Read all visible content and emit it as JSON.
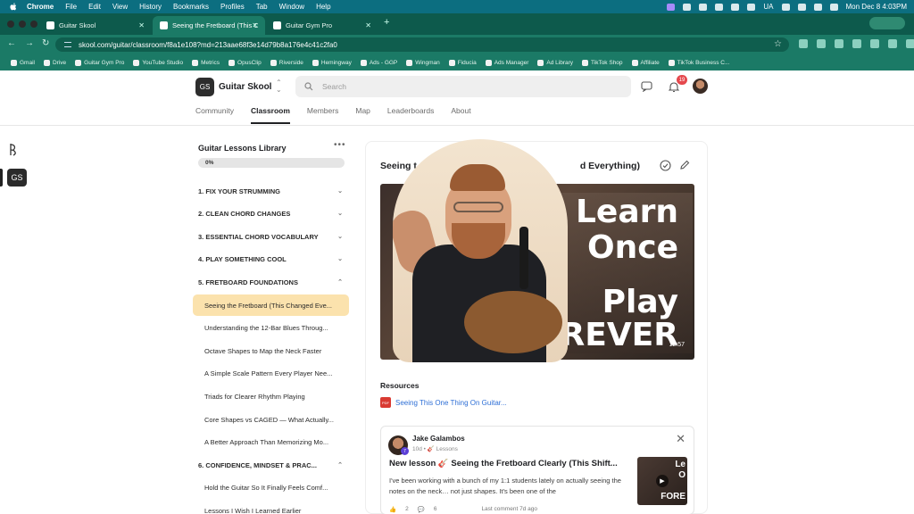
{
  "menubar": {
    "app": "Chrome",
    "items": [
      "File",
      "Edit",
      "View",
      "History",
      "Bookmarks",
      "Profiles",
      "Tab",
      "Window",
      "Help"
    ],
    "locale": "UA",
    "clock": "Mon Dec 8  4:03PM"
  },
  "tabs": [
    {
      "label": "Guitar Skool",
      "active": false
    },
    {
      "label": "Seeing the Fretboard (This C",
      "active": true
    },
    {
      "label": "Guitar Gym Pro",
      "active": false
    }
  ],
  "address": {
    "url": "skool.com/guitar/classroom/f8a1e108?md=213aae68f3e14d79b8a176e4c41c2fa0"
  },
  "bookmarks": [
    "Gmail",
    "Drive",
    "Guitar Gym Pro",
    "YouTube Studio",
    "Metrics",
    "OpusClip",
    "Riverside",
    "Hemingway",
    "Ads - GGP",
    "Wingman",
    "Fiducia",
    "Ads Manager",
    "Ad Library",
    "TikTok Shop",
    "Affiliate",
    "TikTok Business C..."
  ],
  "site": {
    "logo_text": "GS",
    "name": "Guitar Skool",
    "search_placeholder": "Search",
    "notifications": "19",
    "nav": [
      "Community",
      "Classroom",
      "Members",
      "Map",
      "Leaderboards",
      "About"
    ],
    "active_nav": "Classroom"
  },
  "library": {
    "title": "Guitar Lessons Library",
    "progress": "0%",
    "progress_fraction": 0,
    "sections": [
      {
        "label": "1. FIX YOUR STRUMMING",
        "expanded": false
      },
      {
        "label": "2. CLEAN CHORD CHANGES",
        "expanded": false
      },
      {
        "label": "3. ESSENTIAL CHORD VOCABULARY",
        "expanded": false
      },
      {
        "label": "4. PLAY SOMETHING COOL",
        "expanded": false
      },
      {
        "label": "5. FRETBOARD FOUNDATIONS",
        "expanded": true
      },
      {
        "label": "6. CONFIDENCE, MINDSET & PRAC...",
        "expanded": true
      }
    ],
    "lessons5": [
      "Seeing the Fretboard (This Changed Eve...",
      "Understanding the 12-Bar Blues Throug...",
      "Octave Shapes to Map the Neck Faster",
      "A Simple Scale Pattern Every Player Nee...",
      "Triads for Clearer Rhythm Playing",
      "Core Shapes vs CAGED — What Actually...",
      "A Better Approach Than Memorizing Mo..."
    ],
    "lessons6": [
      "Hold the Guitar So It Finally Feels Comf...",
      "Lessons I Wish I Learned Earlier"
    ]
  },
  "lesson": {
    "title_start": "Seeing t",
    "title_end": "d Everything)",
    "video_text": [
      "Learn",
      "Once",
      "Play",
      "FOREVER"
    ],
    "duration": "12:57",
    "resources_label": "Resources",
    "resource_link": "Seeing This One Thing On Guitar...",
    "resource_icon": "PDF"
  },
  "post": {
    "author": "Jake Galambos",
    "badge": "7",
    "meta": "10d • 🎸 Lessons",
    "title": "New lesson 🎸 Seeing the Fretboard Clearly (This Shift...",
    "body": "I've been working with a bunch of my 1:1 students lately on actually seeing the notes on the neck… not just shapes. It's been one of the",
    "likes": "2",
    "comments": "6",
    "last_comment": "Last comment 7d ago",
    "thumb_text": [
      "Le",
      "O",
      "FORE"
    ]
  },
  "colors": {
    "menubar": "#0c6e80",
    "chrome": "#1b7a66",
    "active_lesson": "#fbe2ad",
    "link": "#2e6fd6",
    "badge": "#e5484d"
  }
}
